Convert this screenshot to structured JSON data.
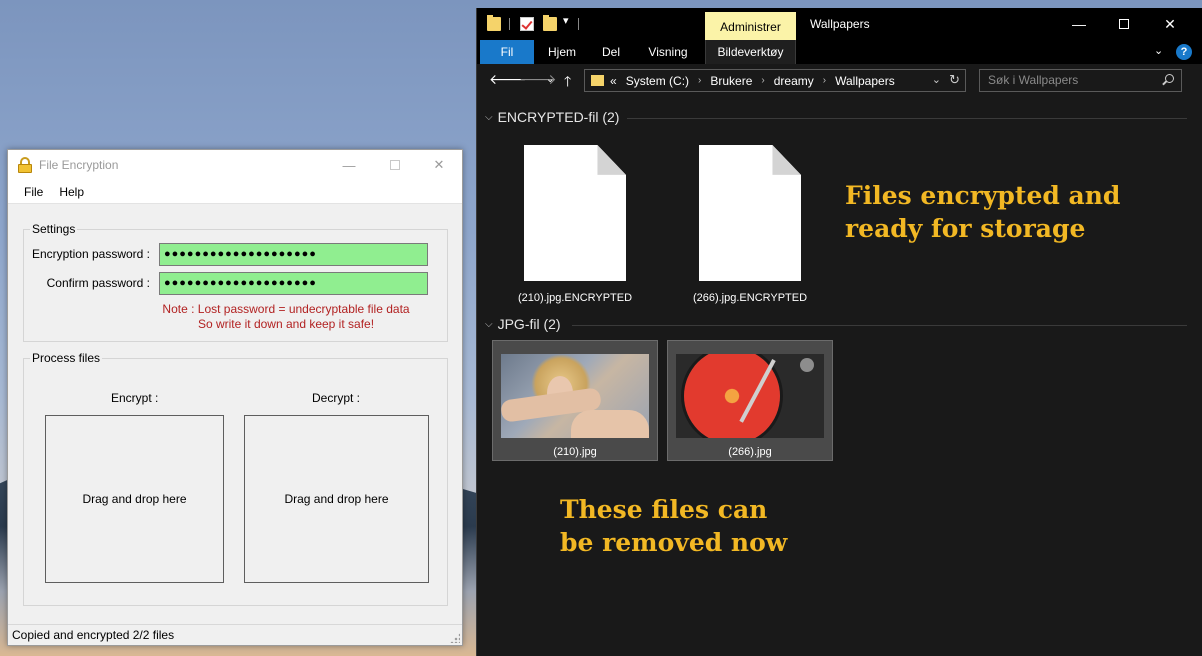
{
  "file_encryption": {
    "title": "File Encryption",
    "menu": [
      "File",
      "Help"
    ],
    "settings": {
      "legend": "Settings",
      "password_label": "Encryption password :",
      "password_value": "●●●●●●●●●●●●●●●●●●●●",
      "confirm_label": "Confirm password :",
      "confirm_value": "●●●●●●●●●●●●●●●●●●●●",
      "note_line1": "Note :  Lost password = undecryptable file data",
      "note_line2": "So write it down and keep it safe!",
      "field_color": "#90ee90"
    },
    "process": {
      "legend": "Process files",
      "encrypt_label": "Encrypt :",
      "decrypt_label": "Decrypt :",
      "encrypt_drop": "Drag and drop here",
      "decrypt_drop": "Drag and drop here"
    },
    "status": "Copied and encrypted 2/2 files"
  },
  "explorer": {
    "context_tab": "Administrer",
    "title": "Wallpapers",
    "ribbon_tabs": [
      "Fil",
      "Hjem",
      "Del",
      "Visning",
      "Bildeverktøy"
    ],
    "address": {
      "overflow": "«",
      "crumbs": [
        "System (C:)",
        "Brukere",
        "dreamy",
        "Wallpapers"
      ]
    },
    "search_placeholder": "Søk i Wallpapers",
    "groups": [
      {
        "header": "ENCRYPTED-fil (2)",
        "files": [
          "(210).jpg.ENCRYPTED",
          "(266).jpg.ENCRYPTED"
        ]
      },
      {
        "header": "JPG-fil (2)",
        "files": [
          "(210).jpg",
          "(266).jpg"
        ]
      }
    ],
    "annotation_top": [
      "Files encrypted and",
      "ready for storage"
    ],
    "annotation_bottom": [
      "These files can",
      "be removed now"
    ],
    "accent_color": "#1979ca",
    "annotation_color": "#f2b824"
  }
}
